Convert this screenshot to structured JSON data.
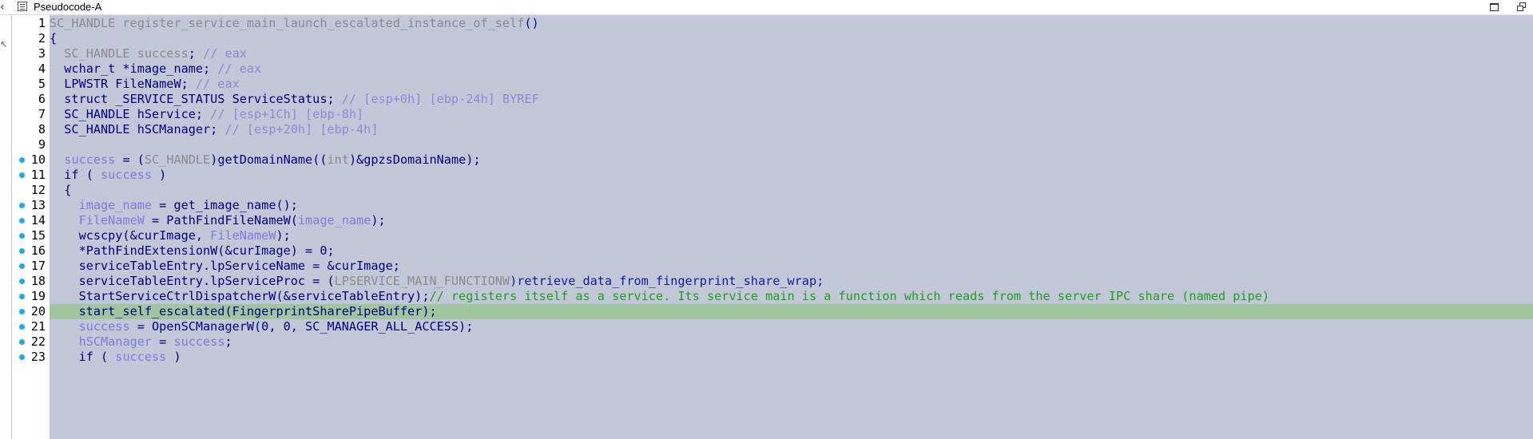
{
  "window": {
    "title": "Pseudocode-A",
    "icons": [
      "left-arrow-icon",
      "pseudocode-view-icon",
      "restore-window-icon",
      "float-window-icon"
    ]
  },
  "colors": {
    "code_background": "#c3c8d9",
    "highlight_line": "#9fc79f",
    "breakpoint_dot": "#21a8e6",
    "keyword": "#000080",
    "comment": "#1e9e1e",
    "local_var": "#7b7be0"
  },
  "highlighted_line": 20,
  "lines": [
    {
      "n": "1",
      "dot": false,
      "tokens": [
        [
          "gray",
          "SC_HANDLE register_service_main_launch_escalated_instance_of_self"
        ],
        [
          "",
          "()"
        ]
      ]
    },
    {
      "n": "2",
      "dot": false,
      "tokens": [
        [
          "",
          "{"
        ]
      ]
    },
    {
      "n": "3",
      "dot": false,
      "tokens": [
        [
          "gray",
          "  SC_HANDLE success"
        ],
        [
          "",
          "; "
        ],
        [
          "cm2",
          "// eax"
        ]
      ]
    },
    {
      "n": "4",
      "dot": false,
      "tokens": [
        [
          "",
          "  wchar_t *image_name; "
        ],
        [
          "cm2",
          "// eax"
        ]
      ]
    },
    {
      "n": "5",
      "dot": false,
      "tokens": [
        [
          "",
          "  LPWSTR FileNameW; "
        ],
        [
          "cm2",
          "// eax"
        ]
      ]
    },
    {
      "n": "6",
      "dot": false,
      "tokens": [
        [
          "",
          "  struct _SERVICE_STATUS ServiceStatus; "
        ],
        [
          "cm2",
          "// [esp+0h] [ebp-24h] BYREF"
        ]
      ]
    },
    {
      "n": "7",
      "dot": false,
      "tokens": [
        [
          "",
          "  SC_HANDLE hService; "
        ],
        [
          "cm2",
          "// [esp+1Ch] [ebp-8h]"
        ]
      ]
    },
    {
      "n": "8",
      "dot": false,
      "tokens": [
        [
          "",
          "  SC_HANDLE hSCManager; "
        ],
        [
          "cm2",
          "// [esp+20h] [ebp-4h]"
        ]
      ]
    },
    {
      "n": "9",
      "dot": false,
      "tokens": [
        [
          "",
          ""
        ]
      ]
    },
    {
      "n": "10",
      "dot": true,
      "tokens": [
        [
          "",
          "  "
        ],
        [
          "ln",
          "success"
        ],
        [
          "",
          " = ("
        ],
        [
          "gray",
          "SC_HANDLE"
        ],
        [
          "",
          ")getDomainName(("
        ],
        [
          "gray",
          "int"
        ],
        [
          "",
          ")&gpzsDomainName);"
        ]
      ]
    },
    {
      "n": "11",
      "dot": true,
      "tokens": [
        [
          "",
          "  if ( "
        ],
        [
          "ln",
          "success"
        ],
        [
          "",
          " )"
        ]
      ]
    },
    {
      "n": "12",
      "dot": false,
      "tokens": [
        [
          "",
          "  {"
        ]
      ]
    },
    {
      "n": "13",
      "dot": true,
      "tokens": [
        [
          "",
          "    "
        ],
        [
          "ln",
          "image_name"
        ],
        [
          "",
          " = get_image_name();"
        ]
      ]
    },
    {
      "n": "14",
      "dot": true,
      "tokens": [
        [
          "",
          "    "
        ],
        [
          "ln",
          "FileNameW"
        ],
        [
          "",
          " = PathFindFileNameW("
        ],
        [
          "ln",
          "image_name"
        ],
        [
          "",
          ");"
        ]
      ]
    },
    {
      "n": "15",
      "dot": true,
      "tokens": [
        [
          "",
          "    wcscpy(&curImage, "
        ],
        [
          "ln",
          "FileNameW"
        ],
        [
          "",
          ");"
        ]
      ]
    },
    {
      "n": "16",
      "dot": true,
      "tokens": [
        [
          "",
          "    *PathFindExtensionW(&curImage) = 0;"
        ]
      ]
    },
    {
      "n": "17",
      "dot": true,
      "tokens": [
        [
          "",
          "    serviceTableEntry.lpServiceName = &curImage;"
        ]
      ]
    },
    {
      "n": "18",
      "dot": true,
      "tokens": [
        [
          "",
          "    serviceTableEntry.lpServiceProc = ("
        ],
        [
          "gray",
          "LPSERVICE_MAIN_FUNCTIONW"
        ],
        [
          "fn",
          ")retrieve_data_from_fingerprint_share_wrap;"
        ]
      ]
    },
    {
      "n": "19",
      "dot": true,
      "tokens": [
        [
          "",
          "    StartServiceCtrlDispatcherW(&serviceTableEntry);"
        ],
        [
          "cm",
          "// registers itself as a service. Its service main is a function which reads from the server IPC share (named pipe)"
        ]
      ]
    },
    {
      "n": "20",
      "dot": true,
      "tokens": [
        [
          "",
          "    start_self_escalated(FingerprintSharePipeBuffer);"
        ]
      ]
    },
    {
      "n": "21",
      "dot": true,
      "tokens": [
        [
          "",
          "    "
        ],
        [
          "ln",
          "success"
        ],
        [
          "",
          " = OpenSCManagerW(0, 0, SC_MANAGER_ALL_ACCESS);"
        ]
      ]
    },
    {
      "n": "22",
      "dot": true,
      "tokens": [
        [
          "",
          "    "
        ],
        [
          "ln",
          "hSCManager"
        ],
        [
          "",
          " = "
        ],
        [
          "ln",
          "success"
        ],
        [
          "",
          ";"
        ]
      ]
    },
    {
      "n": "23",
      "dot": true,
      "tokens": [
        [
          "",
          "    if ( "
        ],
        [
          "ln",
          "success"
        ],
        [
          "",
          " )"
        ]
      ]
    }
  ]
}
